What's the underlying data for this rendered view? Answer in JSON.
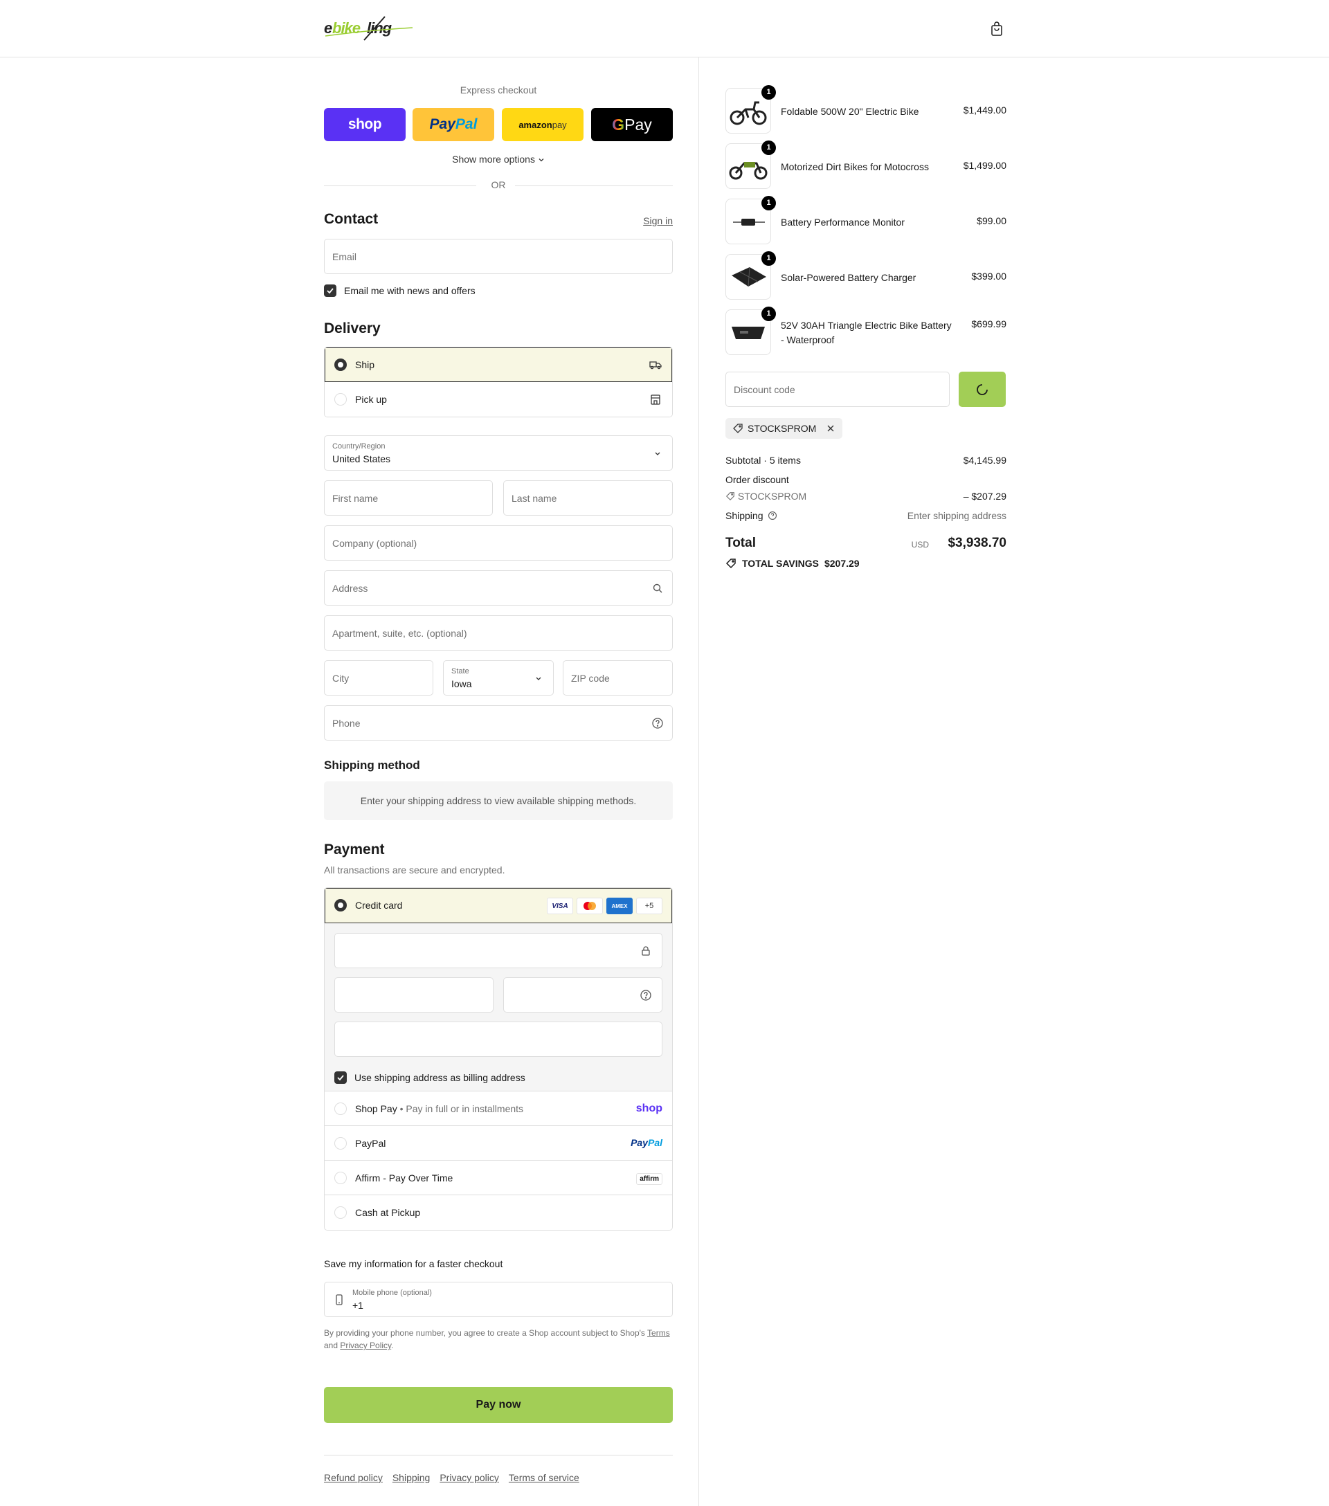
{
  "header": {
    "brand": "ebikeling",
    "cart_icon": "shopping-bag-icon"
  },
  "express": {
    "title": "Express checkout",
    "buttons": {
      "shop": "shop",
      "paypal_a": "Pay",
      "paypal_b": "Pal",
      "amazon_a": "amazon",
      "amazon_b": " pay",
      "gpay_g": "G",
      "gpay_text": " Pay"
    },
    "show_more": "Show more options",
    "or": "OR"
  },
  "contact": {
    "title": "Contact",
    "sign_in": "Sign in",
    "email_placeholder": "Email",
    "newsletter_label": "Email me with news and offers"
  },
  "delivery": {
    "title": "Delivery",
    "options": [
      {
        "label": "Ship",
        "icon": "truck-icon",
        "selected": true
      },
      {
        "label": "Pick up",
        "icon": "store-icon",
        "selected": false
      }
    ],
    "country_label": "Country/Region",
    "country_value": "United States",
    "first_name": "First name",
    "last_name": "Last name",
    "company": "Company (optional)",
    "address": "Address",
    "apartment": "Apartment, suite, etc. (optional)",
    "city": "City",
    "state_label": "State",
    "state_value": "Iowa",
    "zip": "ZIP code",
    "phone": "Phone"
  },
  "shipping_method": {
    "title": "Shipping method",
    "info": "Enter your shipping address to view available shipping methods."
  },
  "payment": {
    "title": "Payment",
    "subtitle": "All transactions are secure and encrypted.",
    "credit_card": "Credit card",
    "card_brands": {
      "visa": "VISA",
      "amex": "AMEX",
      "more": "+5"
    },
    "billing_label": "Use shipping address as billing address",
    "shop_pay": "Shop Pay",
    "shop_pay_sub": "Pay in full or in installments",
    "shop_pay_logo": "shop",
    "paypal": "PayPal",
    "paypal_logo_a": "Pay",
    "paypal_logo_b": "Pal",
    "affirm": "Affirm - Pay Over Time",
    "affirm_logo": "affirm",
    "cash": "Cash at Pickup"
  },
  "save_info": {
    "title": "Save my information for a faster checkout",
    "mobile_label": "Mobile phone (optional)",
    "mobile_value": "+1",
    "terms_a": "By providing your phone number, you agree to create a Shop account subject to Shop's ",
    "terms_link1": "Terms",
    "terms_b": " and ",
    "terms_link2": "Privacy Policy",
    "terms_c": "."
  },
  "pay_now": "Pay now",
  "footer_links": [
    "Refund policy",
    "Shipping",
    "Privacy policy",
    "Terms of service"
  ],
  "order": {
    "items": [
      {
        "name": "Foldable 500W 20\" Electric Bike",
        "price": "$1,449.00",
        "qty": "1"
      },
      {
        "name": "Motorized Dirt Bikes for Motocross",
        "price": "$1,499.00",
        "qty": "1"
      },
      {
        "name": "Battery Performance Monitor",
        "price": "$99.00",
        "qty": "1"
      },
      {
        "name": "Solar-Powered Battery Charger",
        "price": "$399.00",
        "qty": "1"
      },
      {
        "name": "52V 30AH Triangle Electric Bike Battery - Waterproof",
        "price": "$699.99",
        "qty": "1"
      }
    ],
    "discount_placeholder": "Discount code",
    "applied_code": "STOCKSPROM",
    "subtotal_label": "Subtotal · 5 items",
    "subtotal_value": "$4,145.99",
    "order_discount_label": "Order discount",
    "discount_code": "STOCKSPROM",
    "discount_value": "– $207.29",
    "shipping_label": "Shipping",
    "shipping_value": "Enter shipping address",
    "total_label": "Total",
    "currency": "USD",
    "total_value": "$3,938.70",
    "savings_label": "TOTAL SAVINGS",
    "savings_value": "$207.29"
  }
}
